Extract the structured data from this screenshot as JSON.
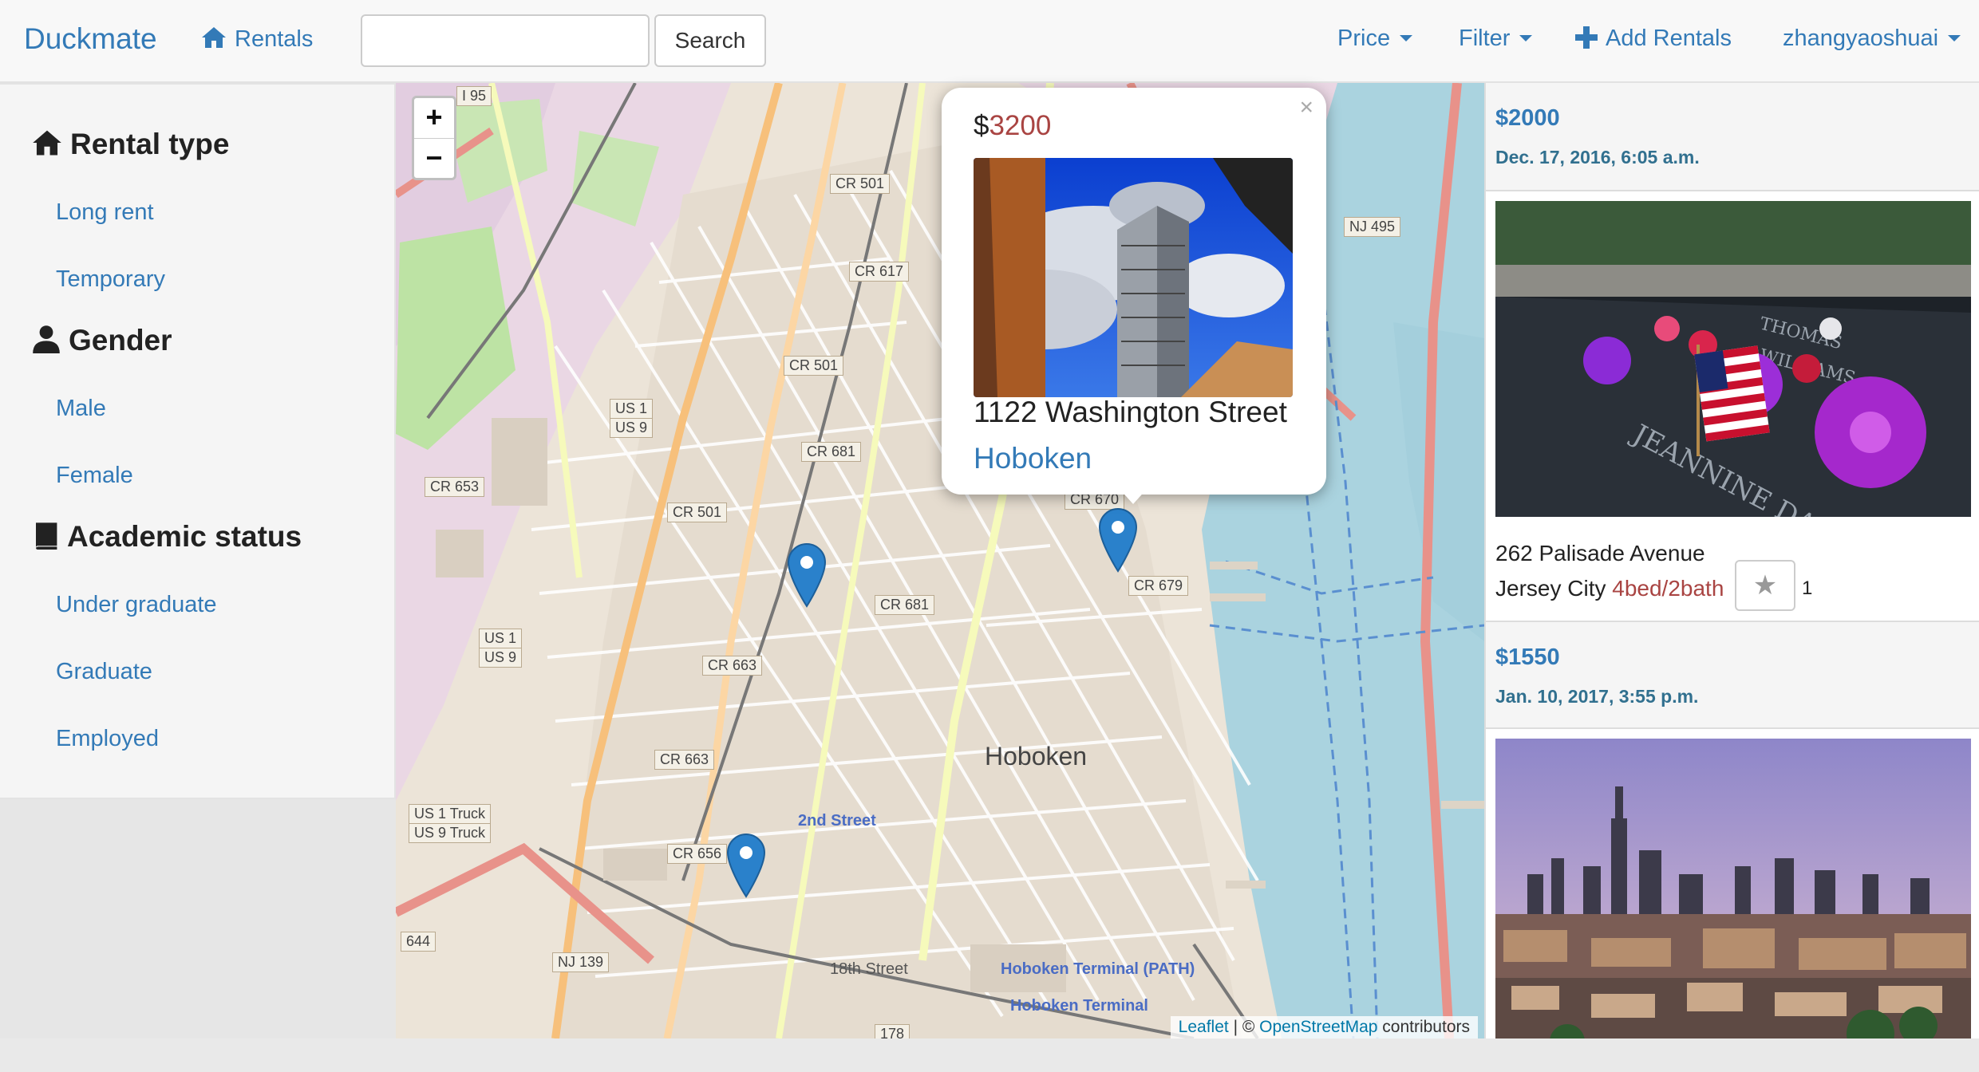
{
  "navbar": {
    "brand": "Duckmate",
    "rentals_link": "Rentals",
    "search_placeholder": "",
    "search_button": "Search",
    "price_menu": "Price",
    "filter_menu": "Filter",
    "add_rentals": "Add Rentals",
    "user_menu": "zhangyaoshuai"
  },
  "sidebar": {
    "rental_type": {
      "heading": "Rental type",
      "items": [
        "Long rent",
        "Temporary"
      ]
    },
    "gender": {
      "heading": "Gender",
      "items": [
        "Male",
        "Female"
      ]
    },
    "academic": {
      "heading": "Academic status",
      "items": [
        "Under graduate",
        "Graduate",
        "Employed"
      ]
    }
  },
  "map": {
    "zoom_in": "+",
    "zoom_out": "−",
    "attribution_leaflet": "Leaflet",
    "attribution_sep": " | © ",
    "attribution_osm": "OpenStreetMap",
    "attribution_tail": " contributors",
    "labels": {
      "hoboken": "Hoboken",
      "second_street": "2nd Street",
      "hoboken_terminal_path": "Hoboken Terminal (PATH)",
      "hoboken_terminal": "Hoboken Terminal",
      "street_18th": "18th Street"
    },
    "shields": {
      "i95": "I 95",
      "cr501a": "CR 501",
      "cr617": "CR 617",
      "cr501b": "CR 501",
      "nj495": "NJ 495",
      "us1": "US 1",
      "us9": "US 9",
      "cr681a": "CR 681",
      "cr653": "CR 653",
      "cr501c": "CR 501",
      "cr670": "CR 670",
      "cr679": "CR 679",
      "cr681b": "CR 681",
      "us1b": "US 1",
      "us9b": "US 9",
      "cr663a": "CR 663",
      "cr663b": "CR 663",
      "us1truck": "US 1 Truck",
      "us9truck": "US 9 Truck",
      "cr656": "CR 656",
      "nj139": "NJ 139",
      "r644": "644",
      "r178": "178"
    },
    "popup": {
      "currency": "$",
      "price": "3200",
      "close": "×",
      "street": "1122 Washington Street",
      "city": "Hoboken"
    }
  },
  "listings": [
    {
      "price": "$2000",
      "date": "Dec. 17, 2016, 6:05 a.m.",
      "street": "262 Palisade Avenue",
      "city": "Jersey City",
      "beds": "4bed/2bath",
      "star": "★",
      "star_count": "1"
    },
    {
      "price": "$1550",
      "date": "Jan. 10, 2017, 3:55 p.m."
    }
  ],
  "colors": {
    "link": "#337ab7",
    "price_red": "#a94442",
    "marker": "#2a81cb"
  }
}
